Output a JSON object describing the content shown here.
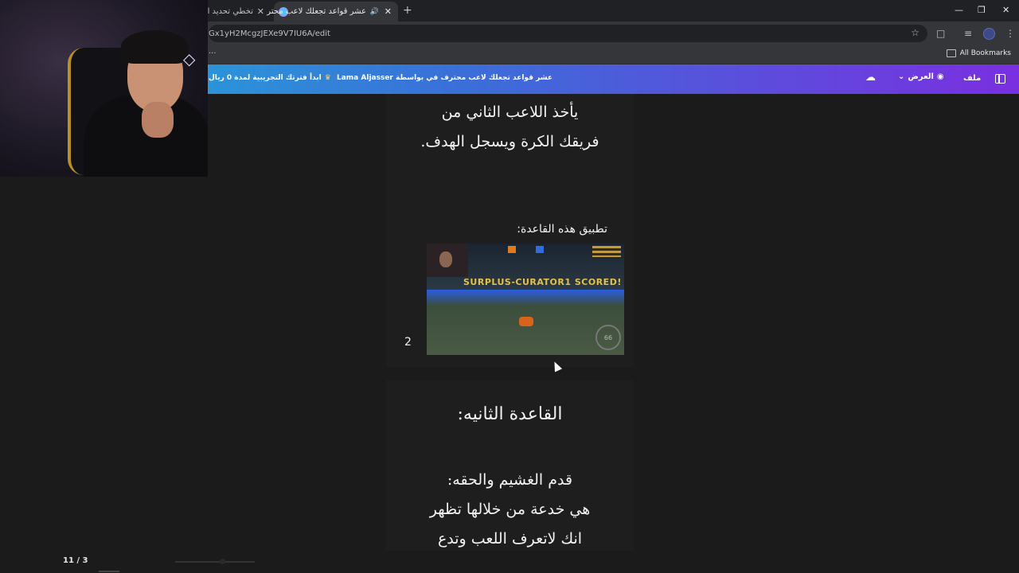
{
  "browser": {
    "tabs": [
      {
        "title": "تخطي تحديد السر",
        "close": "✕"
      },
      {
        "title": "عشر قواعد تجعلك لاعب محتر",
        "close": "✕",
        "audio": "🔊"
      }
    ],
    "new_tab": "+",
    "url": "Gx1yH2McgzJEXe9V7IU6A/edit",
    "bookmarks_label": "All Bookmarks",
    "bookmarks_more": "..."
  },
  "header": {
    "trial": "ابدأ فترتك التجريبية لمدة 0 ريال",
    "crown": "♛",
    "doc_title": "عشر قواعد تجعلك لاعب محترف في بواسطة Lama Aljasser",
    "view_label": "العرض",
    "file_label": "ملف"
  },
  "slide1": {
    "lines": [
      "يأخذ اللاعب الثاني من",
      "فريقك الكرة ويسجل الهدف."
    ],
    "caption": "تطبيق هذه القاعدة:",
    "slide_number": "2",
    "game": {
      "goal_text": "SURPLUS-CURATOR1 SCORED!",
      "boost": "66"
    }
  },
  "slide2": {
    "title": "القاعدة الثانيه:",
    "lines": [
      "قدم الغشيم والحقه:",
      "هي خدعة من خلالها تظهر",
      "انك لاتعرف اللعب وتدع"
    ]
  },
  "footer": {
    "page_counter": "11 / 3"
  }
}
